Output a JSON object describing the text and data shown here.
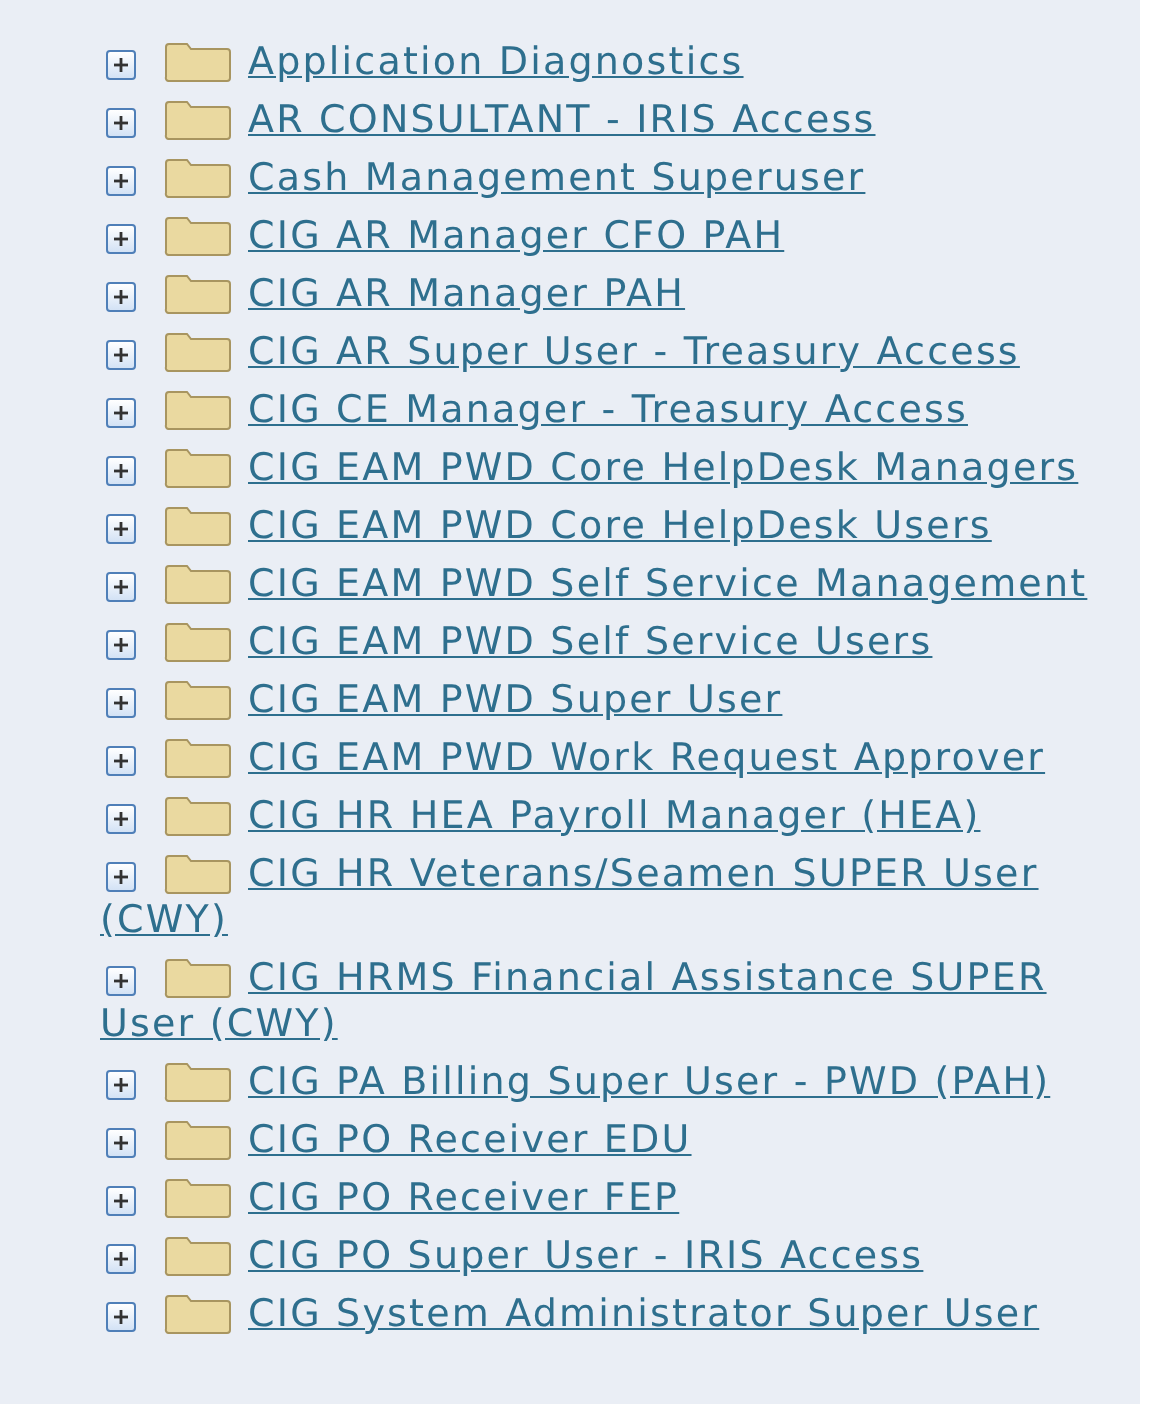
{
  "tree": [
    {
      "label": "Application Diagnostics",
      "expanded": false
    },
    {
      "label": "AR CONSULTANT - IRIS Access",
      "expanded": false
    },
    {
      "label": "Cash Management Superuser",
      "expanded": false
    },
    {
      "label": "CIG AR Manager CFO PAH",
      "expanded": false
    },
    {
      "label": "CIG AR Manager PAH",
      "expanded": false
    },
    {
      "label": "CIG AR Super User - Treasury Access",
      "expanded": false
    },
    {
      "label": "CIG CE Manager - Treasury Access",
      "expanded": false
    },
    {
      "label": "CIG EAM PWD Core HelpDesk Managers",
      "expanded": false
    },
    {
      "label": "CIG EAM PWD Core HelpDesk Users",
      "expanded": false
    },
    {
      "label": "CIG EAM PWD Self Service Management",
      "expanded": false
    },
    {
      "label": "CIG EAM PWD Self Service Users",
      "expanded": false
    },
    {
      "label": "CIG EAM PWD Super User",
      "expanded": false
    },
    {
      "label": "CIG EAM PWD Work Request Approver",
      "expanded": false
    },
    {
      "label": "CIG HR HEA Payroll Manager (HEA)",
      "expanded": false
    },
    {
      "label": "CIG HR Veterans/Seamen SUPER User (CWY)",
      "expanded": false
    },
    {
      "label": "CIG HRMS Financial Assistance SUPER User (CWY)",
      "expanded": false
    },
    {
      "label": "CIG PA Billing Super User - PWD (PAH)",
      "expanded": false
    },
    {
      "label": "CIG PO Receiver EDU",
      "expanded": false
    },
    {
      "label": "CIG PO Receiver FEP",
      "expanded": false
    },
    {
      "label": "CIG PO Super User - IRIS Access",
      "expanded": false
    },
    {
      "label": "CIG System Administrator Super User",
      "expanded": false
    }
  ]
}
